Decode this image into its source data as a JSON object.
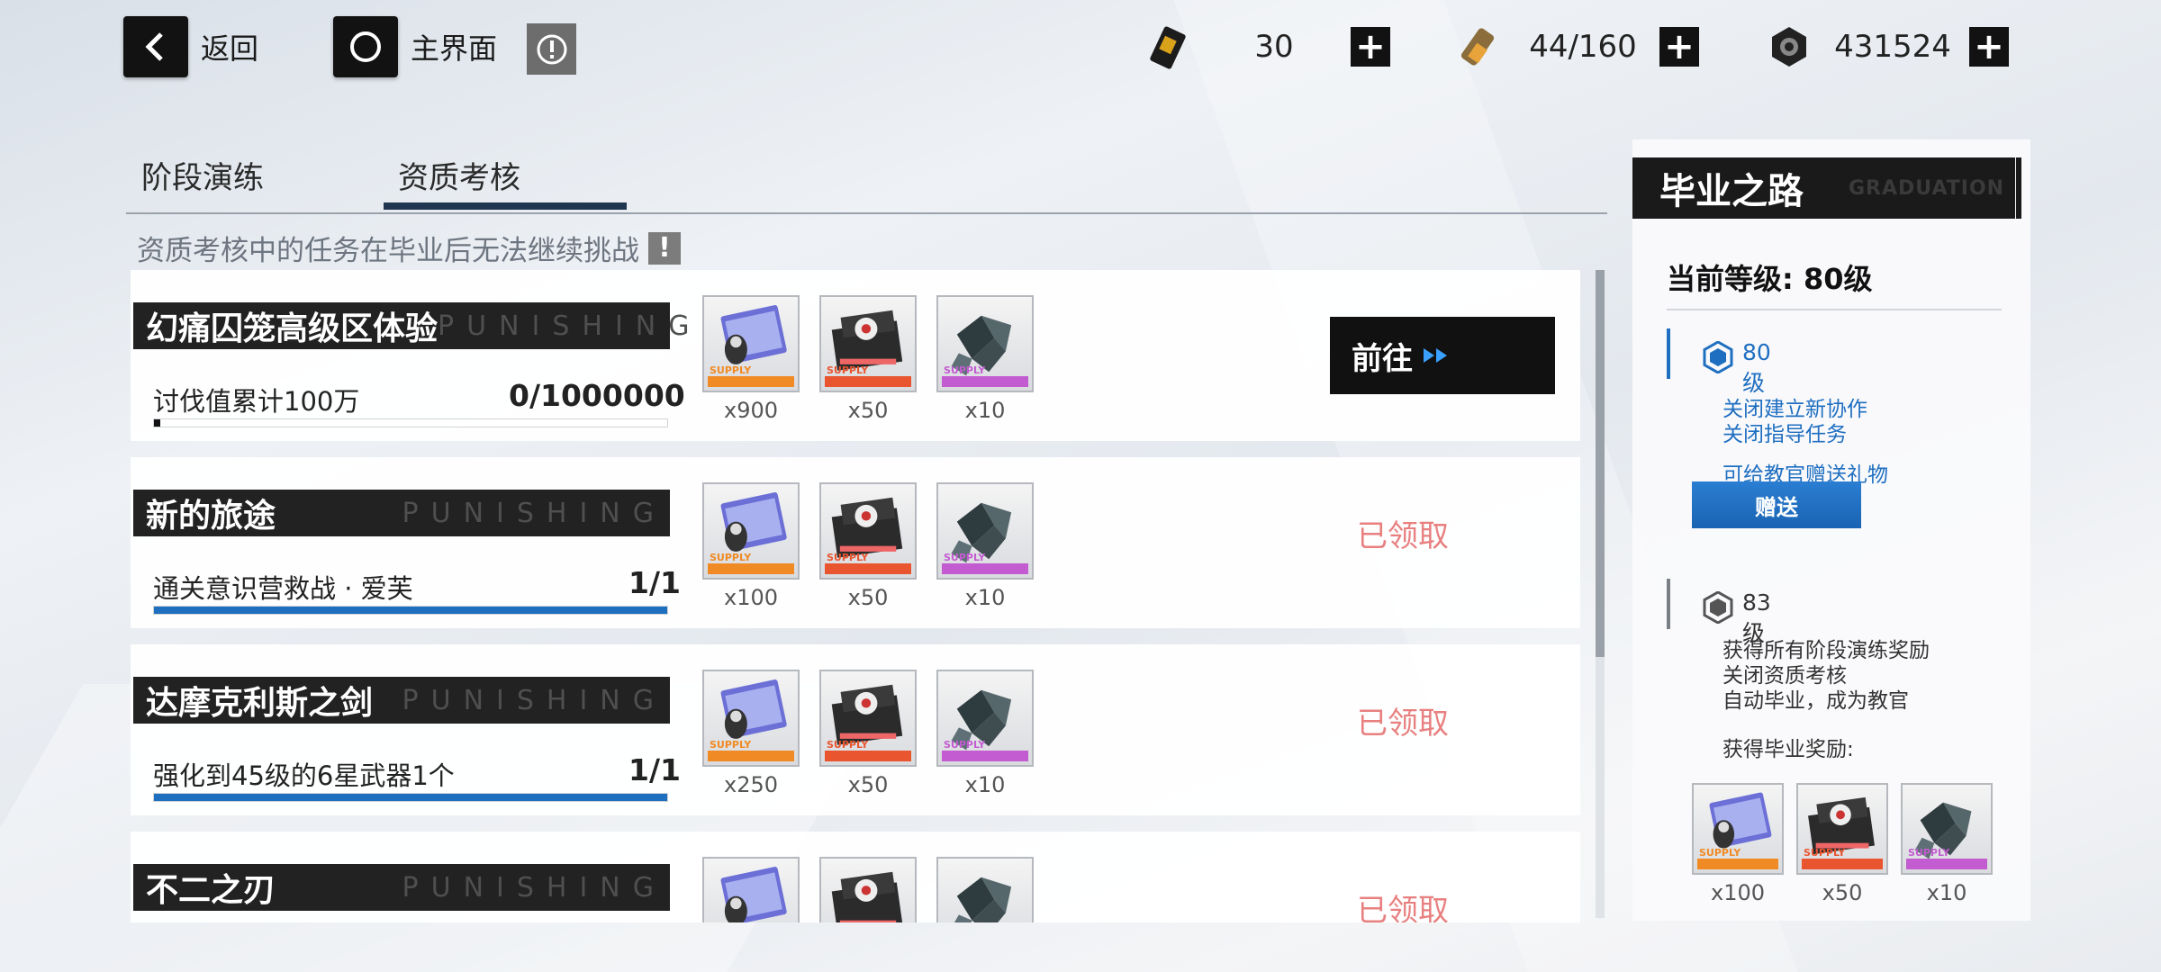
{
  "topbar": {
    "back_label": "返回",
    "home_label": "主界面",
    "resources": [
      {
        "icon": "ticket-icon",
        "value": "30"
      },
      {
        "icon": "battery-icon",
        "value": "44/160"
      },
      {
        "icon": "coin-icon",
        "value": "431524"
      }
    ]
  },
  "tabs": [
    "阶段演练",
    "资质考核"
  ],
  "active_tab": 1,
  "notice": "资质考核中的任务在毕业后无法继续挑战",
  "watermark": "PUNISHING",
  "tasks": [
    {
      "title": "幻痛囚笼高级区体验",
      "desc": "讨伐值累计100万",
      "progress": "0/1000000",
      "fraction": 0.0,
      "rewards": [
        "x900",
        "x50",
        "x10"
      ],
      "status": "goto",
      "action_label": "前往"
    },
    {
      "title": "新的旅途",
      "desc": "通关意识营救战 · 爱芙",
      "progress": "1/1",
      "fraction": 1.0,
      "rewards": [
        "x100",
        "x50",
        "x10"
      ],
      "status": "claimed",
      "action_label": "已领取"
    },
    {
      "title": "达摩克利斯之剑",
      "desc": "强化到45级的6星武器1个",
      "progress": "1/1",
      "fraction": 1.0,
      "rewards": [
        "x250",
        "x50",
        "x10"
      ],
      "status": "claimed",
      "action_label": "已领取"
    },
    {
      "title": "不二之刃",
      "desc": "",
      "progress": "",
      "fraction": 1.0,
      "rewards": [
        "",
        "",
        ""
      ],
      "status": "claimed",
      "action_label": "已领取"
    }
  ],
  "reward_item_labels": [
    "SUPPLY",
    "SUPPLY",
    "SUPPLY"
  ],
  "panel": {
    "title": "毕业之路",
    "title_en": "GRADUATION",
    "current_level": "当前等级: 80级",
    "stage80": {
      "label": "80级",
      "lines": [
        "关闭建立新协作",
        "关闭指导任务",
        "可给教官赠送礼物"
      ],
      "gift_label": "赠送"
    },
    "stage83": {
      "label": "83级",
      "lines": [
        "获得所有阶段演练奖励",
        "关闭资质考核",
        "自动毕业，成为教官",
        "获得毕业奖励:"
      ]
    },
    "rewards": [
      "x100",
      "x50",
      "x10"
    ]
  },
  "colors": {
    "accent": "#1f6fc0",
    "claimed": "#e88080",
    "dark": "#1a1a1a"
  }
}
